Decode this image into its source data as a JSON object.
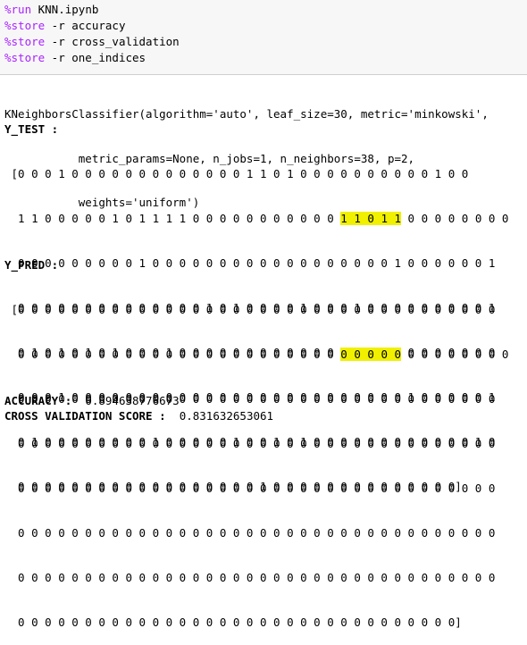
{
  "input_cell": {
    "lines": [
      {
        "magic": "%run",
        "rest": " KNN.ipynb"
      },
      {
        "magic": "%store",
        "rest": " -r accuracy"
      },
      {
        "magic": "%store",
        "rest": " -r cross_validation"
      },
      {
        "magic": "%store",
        "rest": " -r one_indices"
      }
    ]
  },
  "output": {
    "classifier_lines": [
      "KNeighborsClassifier(algorithm='auto', leaf_size=30, metric='minkowski',",
      "           metric_params=None, n_jobs=1, n_neighbors=38, p=2,",
      "           weights='uniform')"
    ],
    "y_test_label": "Y_TEST :",
    "y_test_rows": [
      {
        "pre": " [0 0 0 1 0 0 0 0 0 0 0 0 0 0 0 0 0 1 1 0 1 0 0 0 0 0 0 0 0 0 0 1 0 0",
        "hl": "",
        "post": ""
      },
      {
        "pre": "  1 1 0 0 0 0 0 1 0 1 1 1 1 0 0 0 0 0 0 0 0 0 0 0 ",
        "hl": "1 1 0 1 1",
        "post": " 0 0 0 0 0 0 0 0"
      },
      {
        "pre": "  0 0 0 0 0 0 0 0 0 1 0 0 0 0 0 0 0 0 0 0 0 0 0 0 0 0 0 0 1 0 0 0 0 0 0 1",
        "hl": "",
        "post": ""
      },
      {
        "pre": "  0 0 0 0 0 0 0 0 0 0 0 0 0 0 1 0 1 0 0 0 0 1 0 0 0 1 0 0 0 0 0 0 0 0 0 1",
        "hl": "",
        "post": ""
      },
      {
        "pre": "  0 1 0 1 0 1 0 1 0 0 0 1 0 0 0 0 0 0 0 0 0 0 0 0 0 0 0 0 0 0 0 0 0 0 0 0",
        "hl": "",
        "post": ""
      },
      {
        "pre": "  0 0 0 1 0 0 0 0 0 0 0 0 0 0 0 0 0 0 0 0 0 0 0 0 0 0 0 0 0 1 0 0 0 0 0 1",
        "hl": "",
        "post": ""
      },
      {
        "pre": "  0 1 0 0 0 0 0 0 0 0 1 0 0 0 0 0 1 0 0 1 0 1 0 0 0 0 0 0 0 0 0 0 0 0 1 0",
        "hl": "",
        "post": ""
      },
      {
        "pre": "  0 0 0 0 0 0 0 0 0 0 0 0 0 0 0 0 0 0 1 0 0 0 0 0 0 0 0 0 0 0 0 0 0]",
        "hl": "",
        "post": ""
      }
    ],
    "y_pred_label": "Y_PRED :",
    "y_pred_rows": [
      {
        "pre": " [0 0 0 0 0 0 0 0 0 0 0 0 0 0 0 0 0 0 0 0 0 0 0 0 0 0 0 0 0 0 0 0 0 0 0 0",
        "hl": "",
        "post": ""
      },
      {
        "pre": "  0 0 0 0 0 0 0 0 0 0 0 0 0 0 0 0 0 0 0 0 0 0 0 0 ",
        "hl": "0 0 0 0 0",
        "post": " 0 0 0 0 0 0 0 0"
      },
      {
        "pre": "  0 0 0 0 0 0 0 0 0 0 0 0 0 0 0 0 0 0 0 0 0 0 0 0 0 0 0 0 0 0 0 0 0 0 0 0",
        "hl": "",
        "post": ""
      },
      {
        "pre": "  0 0 0 0 0 0 0 0 0 0 0 0 0 0 0 0 0 0 0 0 0 0 0 0 0 0 0 0 0 0 0 0 0 0 0 0",
        "hl": "",
        "post": ""
      },
      {
        "pre": "  0 0 0 0 0 0 0 0 0 0 0 0 0 0 0 0 0 0 0 0 0 0 0 0 0 0 0 0 0 0 0 0 0 0 0 0",
        "hl": "",
        "post": ""
      },
      {
        "pre": "  0 0 0 0 0 0 0 0 0 0 0 0 0 0 0 0 0 0 0 0 0 0 0 0 0 0 0 0 0 0 0 0 0 0 0 0",
        "hl": "",
        "post": ""
      },
      {
        "pre": "  0 0 0 0 0 0 0 0 0 0 0 0 0 0 0 0 0 0 0 0 0 0 0 0 0 0 0 0 0 0 0 0 0 0 0 0",
        "hl": "",
        "post": ""
      },
      {
        "pre": "  0 0 0 0 0 0 0 0 0 0 0 0 0 0 0 0 0 0 0 0 0 0 0 0 0 0 0 0 0 0 0 0 0]",
        "hl": "",
        "post": ""
      }
    ],
    "accuracy_label": "ACCURACY :",
    "accuracy_value": "0.894638776673",
    "cv_label": "CROSS VALIDATION SCORE :",
    "cv_value": "0.831632653061"
  },
  "colors": {
    "magic": "#aa22ff",
    "highlight": "#f0f000",
    "cell_bg": "#f7f7f7"
  }
}
